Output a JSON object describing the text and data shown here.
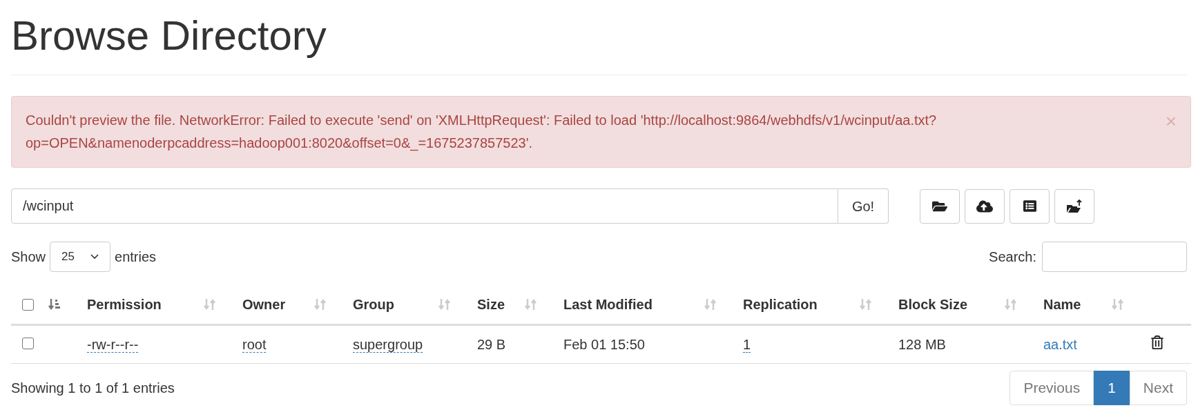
{
  "title": "Browse Directory",
  "alert": {
    "message": "Couldn't preview the file. NetworkError: Failed to execute 'send' on 'XMLHttpRequest': Failed to load 'http://localhost:9864/webhdfs/v1/wcinput/aa.txt?op=OPEN&namenoderpcaddress=hadoop001:8020&offset=0&_=1675237857523'.",
    "close": "×"
  },
  "path": {
    "value": "/wcinput",
    "button": "Go!"
  },
  "length_menu": {
    "label_before": "Show",
    "value": "25",
    "label_after": "entries"
  },
  "search": {
    "label": "Search:"
  },
  "table": {
    "select_all": {
      "checked": false
    },
    "columns": [
      {
        "kind": "checkbox",
        "sorted": true
      },
      {
        "kind": "text",
        "label": "Permission",
        "sorted": false
      },
      {
        "kind": "text",
        "label": "Owner",
        "sorted": false
      },
      {
        "kind": "text",
        "label": "Group",
        "sorted": false
      },
      {
        "kind": "text",
        "label": "Size",
        "sorted": false
      },
      {
        "kind": "text",
        "label": "Last Modified",
        "sorted": false
      },
      {
        "kind": "text",
        "label": "Replication",
        "sorted": false
      },
      {
        "kind": "text",
        "label": "Block Size",
        "sorted": false
      },
      {
        "kind": "text",
        "label": "Name",
        "sorted": false
      },
      {
        "kind": "blank"
      }
    ],
    "rows": [
      {
        "cells": [
          {
            "kind": "checkbox",
            "checked": false
          },
          {
            "kind": "editable",
            "text": "-rw-r--r--"
          },
          {
            "kind": "editable",
            "text": "root"
          },
          {
            "kind": "editable",
            "text": "supergroup"
          },
          {
            "kind": "plain",
            "text": "29 B"
          },
          {
            "kind": "plain",
            "text": "Feb 01 15:50"
          },
          {
            "kind": "editable",
            "text": "1"
          },
          {
            "kind": "plain",
            "text": "128 MB"
          },
          {
            "kind": "link",
            "text": "aa.txt"
          },
          {
            "kind": "delete"
          }
        ]
      }
    ]
  },
  "info": "Showing 1 to 1 of 1 entries",
  "pagination": [
    {
      "label": "Previous",
      "selected": false
    },
    {
      "label": "1",
      "selected": true
    },
    {
      "label": "Next",
      "selected": false
    }
  ]
}
